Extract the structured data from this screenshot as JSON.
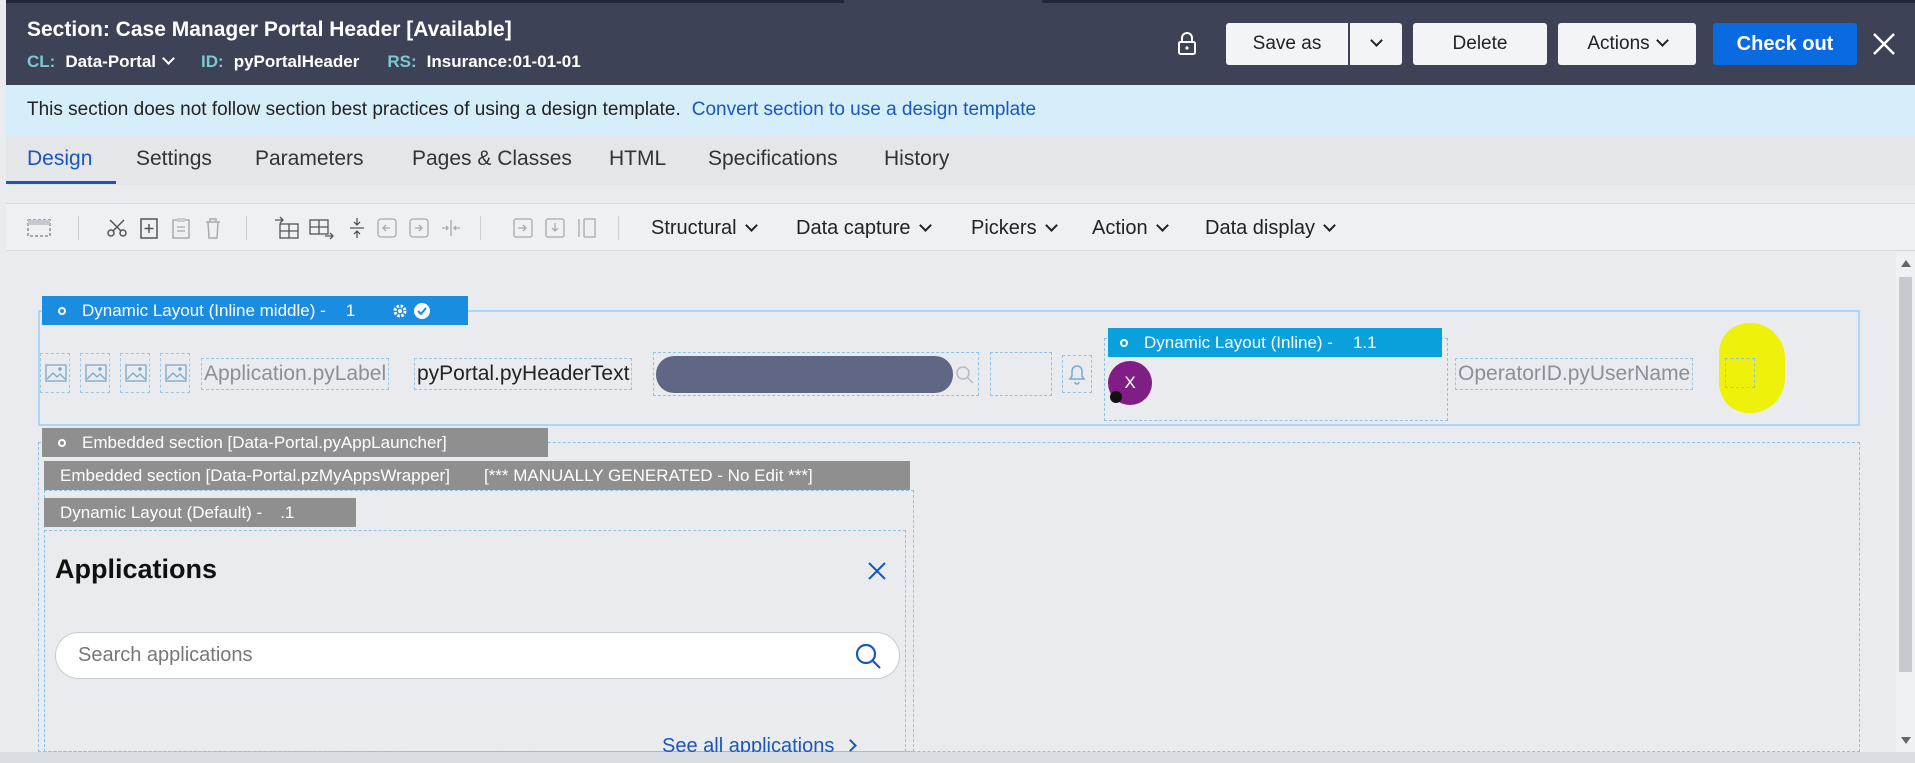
{
  "header": {
    "title": "Section: Case Manager Portal Header [Available]",
    "cl_label": "CL:",
    "cl_value": "Data-Portal",
    "id_label": "ID:",
    "id_value": "pyPortalHeader",
    "rs_label": "RS:",
    "rs_value": "Insurance:01-01-01",
    "save_as": "Save as",
    "delete": "Delete",
    "actions": "Actions",
    "check_out": "Check out"
  },
  "banner": {
    "message": "This section does not follow section best practices of using a design template.",
    "link": "Convert section to use a design template"
  },
  "tabs": [
    "Design",
    "Settings",
    "Parameters",
    "Pages & Classes",
    "HTML",
    "Specifications",
    "History"
  ],
  "toolbar": {
    "menus": [
      "Structural",
      "Data capture",
      "Pickers",
      "Action",
      "Data display"
    ]
  },
  "canvas": {
    "dl_inline_middle": "Dynamic Layout (Inline middle) -",
    "dl_inline_middle_num": "1",
    "application_label": "Application.pyLabel",
    "header_text": "pyPortal.pyHeaderText",
    "dl_inline": "Dynamic Layout (Inline) -",
    "dl_inline_num": "1.1",
    "avatar_initial": "X",
    "operator_username": "OperatorID.pyUserName",
    "embedded_app_launcher": "Embedded section [Data-Portal.pyAppLauncher]",
    "embedded_my_apps": "Embedded section [Data-Portal.pzMyAppsWrapper]",
    "manually_generated": "[*** MANUALLY GENERATED - No Edit ***]",
    "dl_default": "Dynamic Layout (Default) -",
    "dl_default_num": ".1"
  },
  "applications_panel": {
    "title": "Applications",
    "search_placeholder": "Search applications",
    "see_all": "See all applications"
  },
  "colors": {
    "header_bg": "#3d4256",
    "primary": "#0a6ae0",
    "link": "#1a56bf",
    "banner_bg": "#d5eefa",
    "highlight": "#eef20a",
    "avatar": "#7f1f86"
  }
}
